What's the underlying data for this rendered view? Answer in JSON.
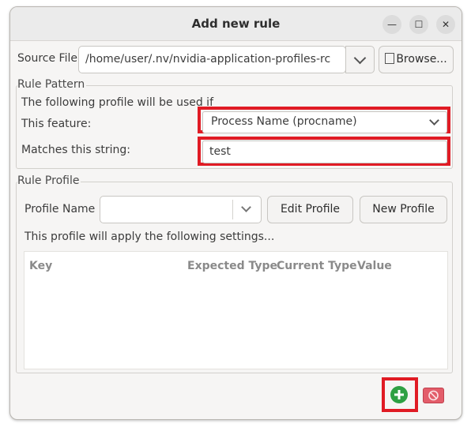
{
  "window": {
    "title": "Add new rule"
  },
  "title_buttons": {
    "minimize": "—",
    "maximize": "☐",
    "close": "✕"
  },
  "source_file": {
    "label": "Source File",
    "value": "/home/user/.nv/nvidia-application-profiles-rc",
    "browse_label": "Browse..."
  },
  "rule_pattern": {
    "legend": "Rule Pattern",
    "description": "The following profile will be used if",
    "feature_label": "This feature:",
    "feature_value": "Process Name (procname)",
    "match_label": "Matches this string:",
    "match_value": "test"
  },
  "rule_profile": {
    "legend": "Rule Profile",
    "profile_name_label": "Profile Name",
    "profile_name_value": "",
    "edit_profile_label": "Edit Profile",
    "new_profile_label": "New Profile",
    "settings_description": "This profile will apply the following settings...",
    "table_headers": {
      "key": "Key",
      "expected_type": "Expected Type",
      "current_type": "Current Type",
      "value": "Value"
    }
  },
  "colors": {
    "highlight": "#e01b24",
    "add": "#2ea043",
    "remove": "#e35d6a"
  },
  "icons": {
    "add": "plus-circle-icon",
    "remove": "no-entry-icon",
    "browse": "file-icon"
  }
}
